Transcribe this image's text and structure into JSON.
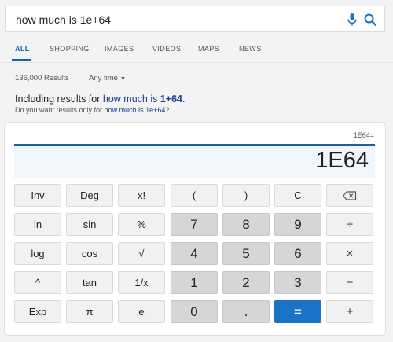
{
  "search": {
    "query": "how much is 1e+64"
  },
  "tabs": [
    {
      "label": "ALL"
    },
    {
      "label": "SHOPPING"
    },
    {
      "label": "IMAGES"
    },
    {
      "label": "VIDEOS"
    },
    {
      "label": "MAPS"
    },
    {
      "label": "NEWS"
    }
  ],
  "results": {
    "count": "136,000 Results",
    "time_filter": "Any time"
  },
  "including": {
    "prefix": "Including results for",
    "query_plain": "how much is",
    "query_bold": "1+64",
    "suffix": "."
  },
  "did_you_mean": {
    "prefix": "Do you want results only for",
    "query": "how much is 1e+64",
    "suffix": "?"
  },
  "calculator": {
    "expression": "1E64=",
    "display": "1E64",
    "keys": [
      [
        "Inv",
        "Deg",
        "x!",
        "(",
        ")",
        "C",
        "backspace"
      ],
      [
        "ln",
        "sin",
        "%",
        "7",
        "8",
        "9",
        "÷"
      ],
      [
        "log",
        "cos",
        "√",
        "4",
        "5",
        "6",
        "×"
      ],
      [
        "^",
        "tan",
        "1/x",
        "1",
        "2",
        "3",
        "−"
      ],
      [
        "Exp",
        "π",
        "e",
        "0",
        ".",
        "=",
        "+"
      ]
    ]
  },
  "icons": {
    "mic": "microphone-icon",
    "search": "search-icon",
    "backspace": "backspace-icon"
  },
  "colors": {
    "accent": "#1a5fa8",
    "equals": "#1a73c6",
    "mic": "#1a73c6"
  }
}
